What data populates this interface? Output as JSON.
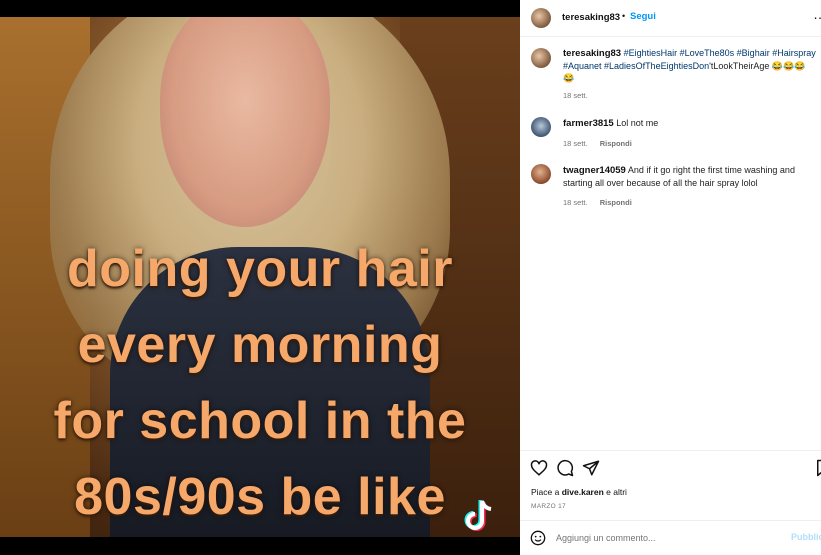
{
  "media": {
    "caption_lines": [
      "doing your hair",
      "every morning",
      "for school in the",
      "80s/90s be like"
    ],
    "watermark_icon": "tiktok-logo-icon"
  },
  "header": {
    "username": "teresaking83",
    "separator": "•",
    "follow_label": "Segui",
    "more_icon": "more-options-icon"
  },
  "post": {
    "username": "teresaking83",
    "hashtags_line1": "#EightiesHair #LoveThe80s #Bighair #Hairspray",
    "hashtags_line2_a": "#Aquanet #LadiesOfTheEightiesDon",
    "hashtags_line2_b": "'tLookTheirAge 😂😂😂",
    "emoji_line3": "😂",
    "time": "18 sett."
  },
  "comments": [
    {
      "username": "farmer3815",
      "text": "Lol not me",
      "time": "18 sett.",
      "reply_label": "Rispondi"
    },
    {
      "username": "twagner14059",
      "text": "And if it go right the first time washing and starting all over because of all the hair spray lolol",
      "time": "18 sett.",
      "reply_label": "Rispondi"
    }
  ],
  "actions": {
    "icons": [
      "heart-icon",
      "comment-icon",
      "share-icon",
      "bookmark-icon"
    ],
    "likes_prefix": "Piace a ",
    "likes_user": "dive.karen",
    "likes_suffix": " e altri",
    "date": "MARZO 17"
  },
  "add_comment": {
    "placeholder": "Aggiungi un commento...",
    "post_label": "Pubblica"
  },
  "colors": {
    "link_blue": "#0095f6",
    "caption_orange": "#f5a86a",
    "hashtag_blue": "#00376b"
  }
}
